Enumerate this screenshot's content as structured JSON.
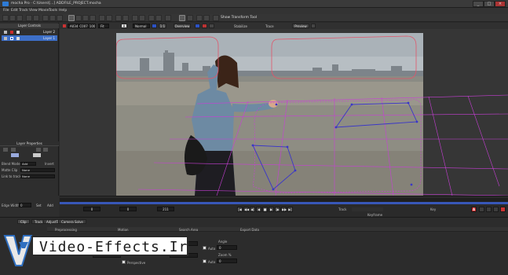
{
  "window": {
    "title": "mocha Pro · C:\\Users\\[...] ADDFILE_PROJECT.mocha",
    "min": "_",
    "max": "□",
    "close": "×"
  },
  "menu": [
    "File",
    "Edit",
    "Track",
    "View",
    "Movie",
    "Tools",
    "Help"
  ],
  "toolbar": {
    "clip_name": "A034_C007_1002",
    "fit_label": "Fit",
    "show_transform": "Show Transform Tool"
  },
  "toolbar2": {
    "view_mode": "Normal",
    "zoom": "1:1",
    "overview": "Overview",
    "stabilize": "Stabilize",
    "trace": "Trace",
    "preview": "Preview"
  },
  "left_panel": {
    "layer_controls_title": "Layer Controls",
    "layers": [
      {
        "name": "Layer 2",
        "color": "#cc2a2a"
      },
      {
        "name": "Layer 1",
        "color": "#2f5fd0",
        "selected": true
      }
    ],
    "layer_properties_title": "Layer Properties",
    "blend_mode_label": "Blend Mode",
    "blend_mode": "Add",
    "invert_label": "Invert",
    "matte_clip_label": "Matte Clip",
    "matte_clip": "None",
    "link_label": "Link to track",
    "link": "None",
    "edge_props_title": "Edge Properties",
    "edge_width_label": "Edge Width",
    "edge_width": "0",
    "set_label": "Set",
    "add_label": "Add"
  },
  "timeline": {
    "in_frame": "0",
    "current_frame": "0",
    "out_frame": "211",
    "keyframe_label": "Keyframe",
    "track_label": "Track",
    "key_label": "Key",
    "buttons": [
      "|◀",
      "◀◀",
      "◀|",
      "◀",
      "■",
      "▶",
      "|▶",
      "▶▶",
      "▶|"
    ]
  },
  "bottom": {
    "tabs": [
      "Clip",
      "Track",
      "AdjustTrack",
      "Camera Solve"
    ],
    "side_tab": "Clip View",
    "sections": [
      "Preprocessing",
      "Motion",
      "Search Area",
      "Export Data"
    ],
    "angle_label": "Angle",
    "angle_value": "0",
    "zoom_label": "Zoom %",
    "zoom_value": "0",
    "auto_label": "Auto",
    "perspective_label": "Perspective"
  },
  "watermark": {
    "text": "Video-Effects.Ir"
  },
  "colors": {
    "spline_red": "#e0556a",
    "grid_magenta": "#c83fd6",
    "track_blue": "#3a36c8",
    "accent_blue": "#3857b8"
  }
}
